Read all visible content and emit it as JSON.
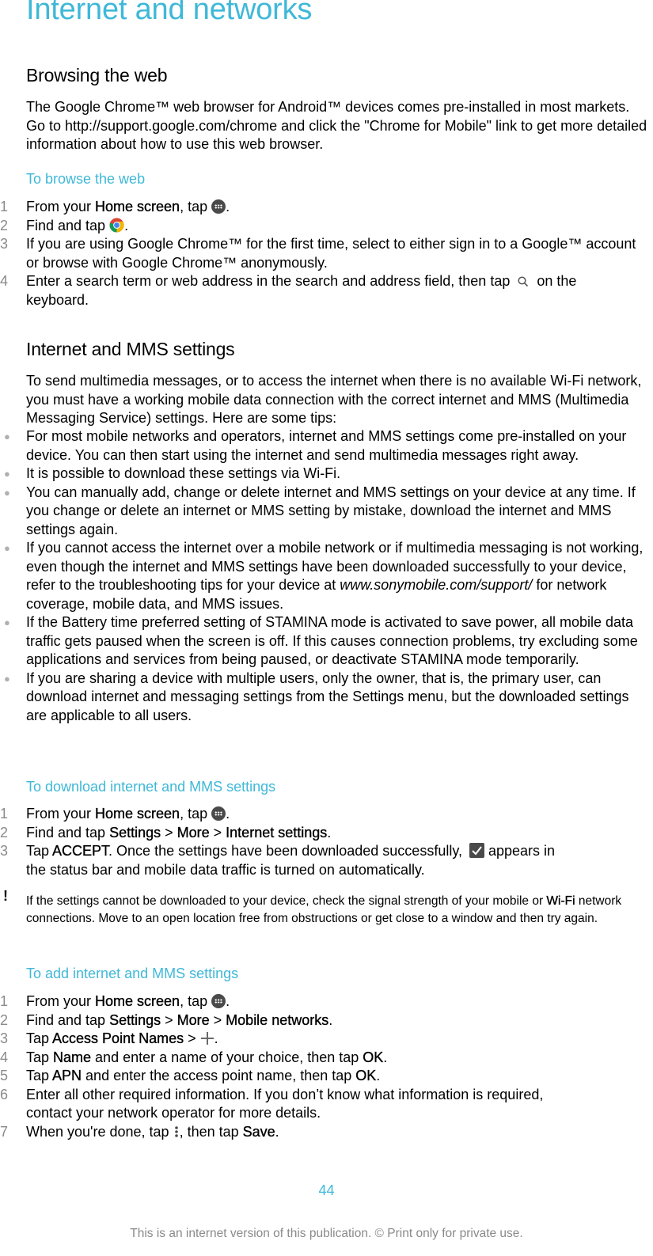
{
  "page": {
    "title": "Internet and networks",
    "page_number": "44",
    "footer": "This is an internet version of this publication. © Print only for private use."
  },
  "browsing": {
    "heading": "Browsing the web",
    "intro": "The Google Chrome™ web browser for Android™ devices comes pre-installed in most markets. Go to http://support.google.com/chrome and click the \"Chrome for Mobile\" link to get more detailed information about how to use this web browser.",
    "task_title": "To browse the web",
    "steps": [
      {
        "num": "1",
        "pre": "From your ",
        "ui": "Home screen",
        "post": ", tap ",
        "icon": "apps-icon",
        "end": "."
      },
      {
        "num": "2",
        "pre": "Find and tap ",
        "icon": "chrome-icon",
        "end": "."
      },
      {
        "num": "3",
        "text": "If you are using Google Chrome™ for the first time, select to either sign in to a Google™ account or browse with Google Chrome™ anonymously."
      },
      {
        "num": "4",
        "pre": "Enter a search term or web address in the search and address field, then tap ",
        "icon": "search-icon",
        "end": " on the keyboard."
      }
    ]
  },
  "mms": {
    "heading": "Internet and MMS settings",
    "intro": "To send multimedia messages, or to access the internet when there is no available Wi-Fi network, you must have a working mobile data connection with the correct internet and MMS (Multimedia Messaging Service) settings. Here are some tips:",
    "bullets": [
      "For most mobile networks and operators, internet and MMS settings come pre-installed on your device. You can then start using the internet and send multimedia messages right away.",
      "It is possible to download these settings via Wi-Fi.",
      "You can manually add, change or delete internet and MMS settings on your device at any time. If you change or delete an internet or MMS setting by mistake, download the internet and MMS settings again.",
      {
        "pre": "If you cannot access the internet over a mobile network or if multimedia messaging is not working, even though the internet and MMS settings have been downloaded successfully to your device, refer to the troubleshooting tips for your device at ",
        "link": "www.sonymobile.com/support/",
        "post": " for network coverage, mobile data, and MMS issues."
      },
      "If the Battery time preferred setting of STAMINA mode is activated to save power, all mobile data traffic gets paused when the screen is off. If this causes connection problems, try excluding some applications and services from being paused, or deactivate STAMINA mode temporarily.",
      "If you are sharing a device with multiple users, only the owner, that is, the primary user, can download internet and messaging settings from the Settings menu, but the downloaded settings are applicable to all users."
    ]
  },
  "download": {
    "task_title": "To download internet and MMS settings",
    "steps": [
      {
        "num": "1",
        "pre": "From your ",
        "ui": "Home screen",
        "post": ", tap ",
        "end": "."
      },
      {
        "num": "2",
        "pre": "Find and tap ",
        "ui1": "Settings",
        "sep1": " > ",
        "ui2": "More",
        "sep2": " > ",
        "ui3": "Internet settings",
        "end": "."
      },
      {
        "num": "3",
        "pre": "Tap ",
        "ui": "ACCEPT",
        "post": ". Once the settings have been downloaded successfully, ",
        "icon": "checkbox-icon",
        "end": " appears in the status bar and mobile data traffic is turned on automatically."
      }
    ],
    "note": {
      "icon": "!",
      "pre": "If the settings cannot be downloaded to your device, check the signal strength of your mobile or ",
      "ui": "Wi-Fi",
      "post": " network connections. Move to an open location free from obstructions or get close to a window and then try again."
    }
  },
  "add": {
    "task_title": "To add internet and MMS settings",
    "steps": [
      {
        "num": "1",
        "pre": "From your ",
        "ui": "Home screen",
        "post": ", tap ",
        "end": "."
      },
      {
        "num": "2",
        "pre": "Find and tap ",
        "ui1": "Settings",
        "sep1": " > ",
        "ui2": "More",
        "sep2": " > ",
        "ui3": "Mobile networks",
        "end": "."
      },
      {
        "num": "3",
        "pre": "Tap ",
        "ui": "Access Point Names",
        "post": " > ",
        "icon": "plus-icon",
        "end": "."
      },
      {
        "num": "4",
        "pre": "Tap ",
        "ui": "Name",
        "post": " and enter a name of your choice, then tap ",
        "ui2": "OK",
        "end": "."
      },
      {
        "num": "5",
        "pre": "Tap ",
        "ui": "APN",
        "post": " and enter the access point name, then tap ",
        "ui2": "OK",
        "end": "."
      },
      {
        "num": "6",
        "text": "Enter all other required information. If you don’t know what information is required, contact your network operator for more details."
      },
      {
        "num": "7",
        "pre": "When you're done, tap ",
        "icon": "more-vert-icon",
        "post": ", then tap ",
        "ui": "Save",
        "end": "."
      }
    ]
  },
  "colors": {
    "accent": "#3fb8d8",
    "text": "#000000",
    "muted": "#8a8a8a"
  }
}
